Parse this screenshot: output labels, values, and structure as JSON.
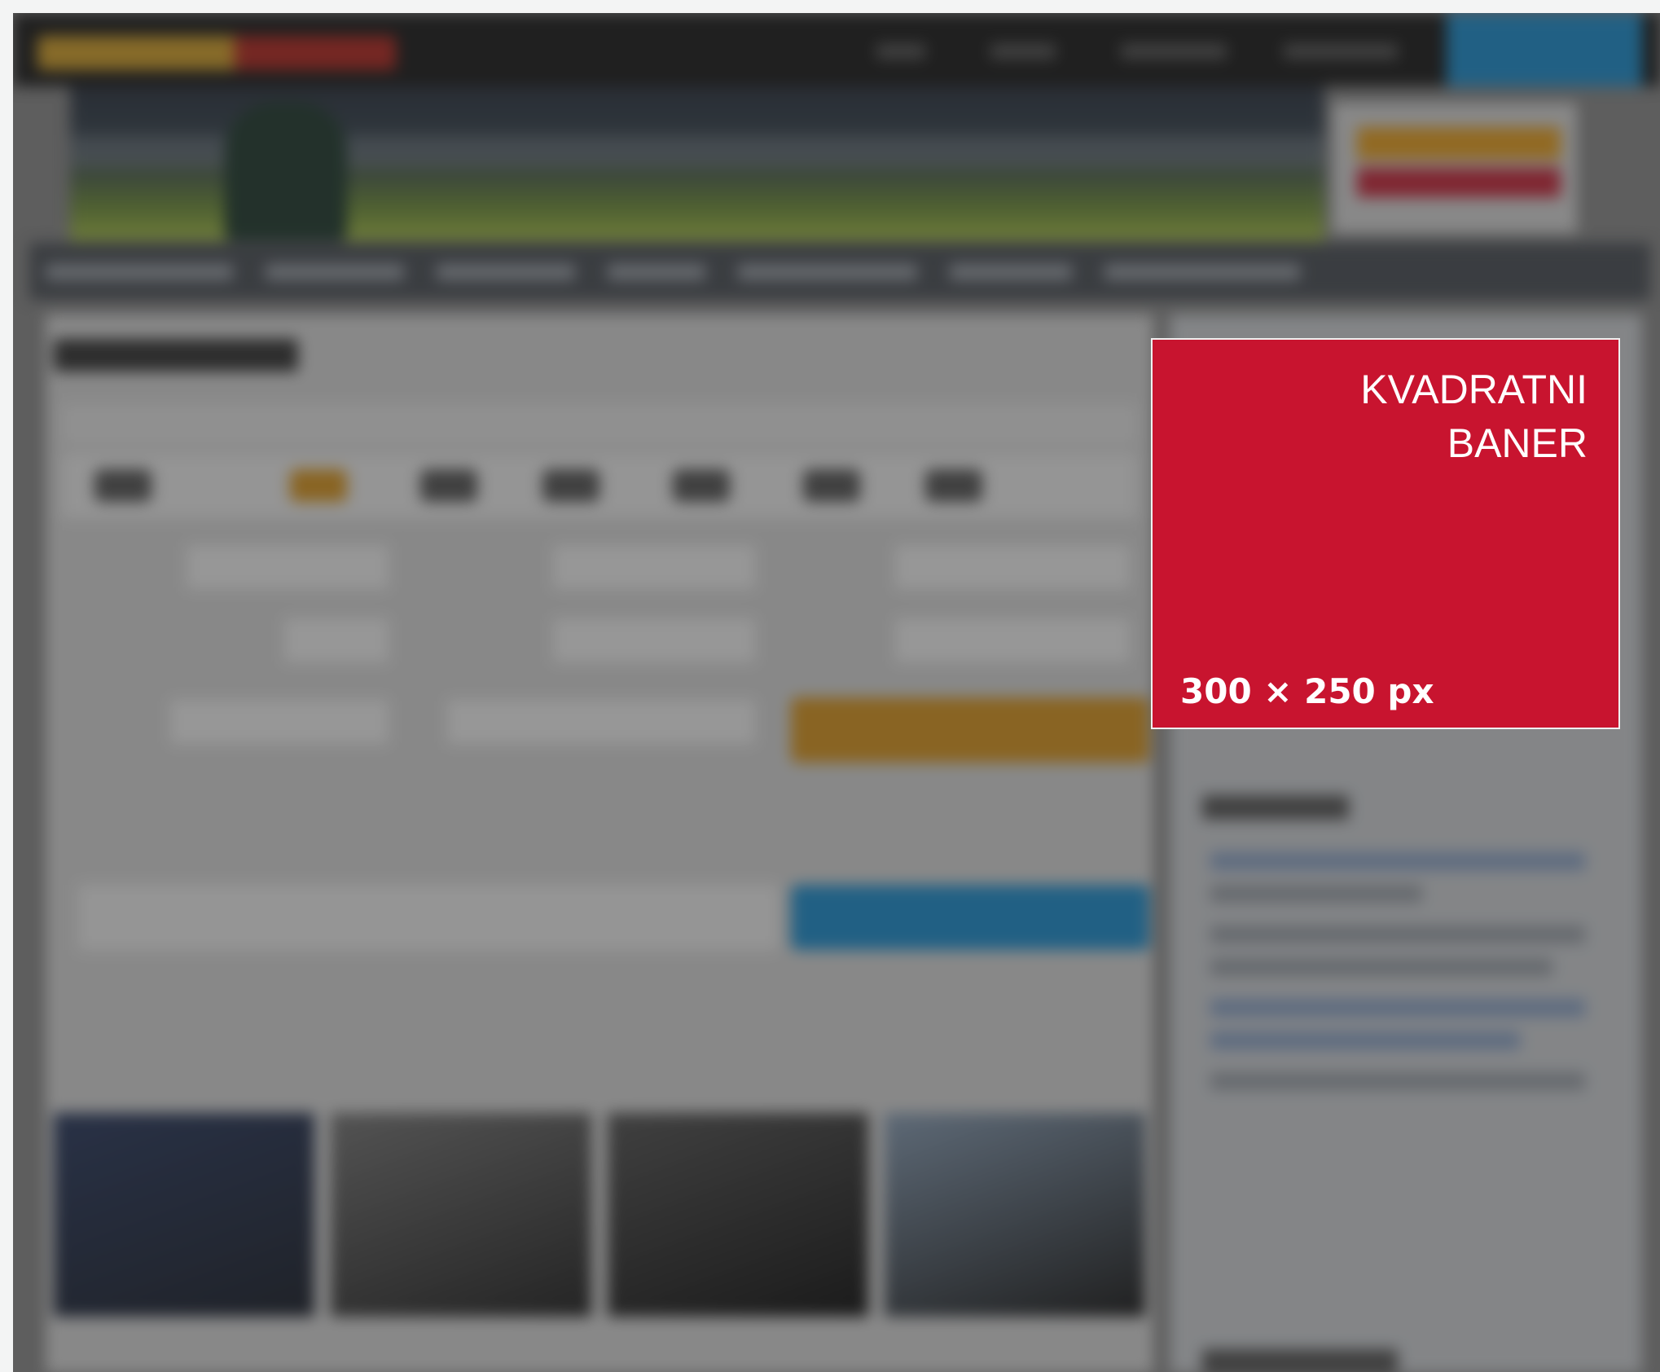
{
  "ad": {
    "title": "KVADRATNI BANER",
    "size": "300 × 250 px",
    "background": "#c8142f",
    "text_color": "#ffffff"
  },
  "colors": {
    "overlay": "#282828",
    "accent_orange": "#d9961f",
    "accent_blue": "#1d8fd0",
    "topbar": "#1a1a1a"
  }
}
